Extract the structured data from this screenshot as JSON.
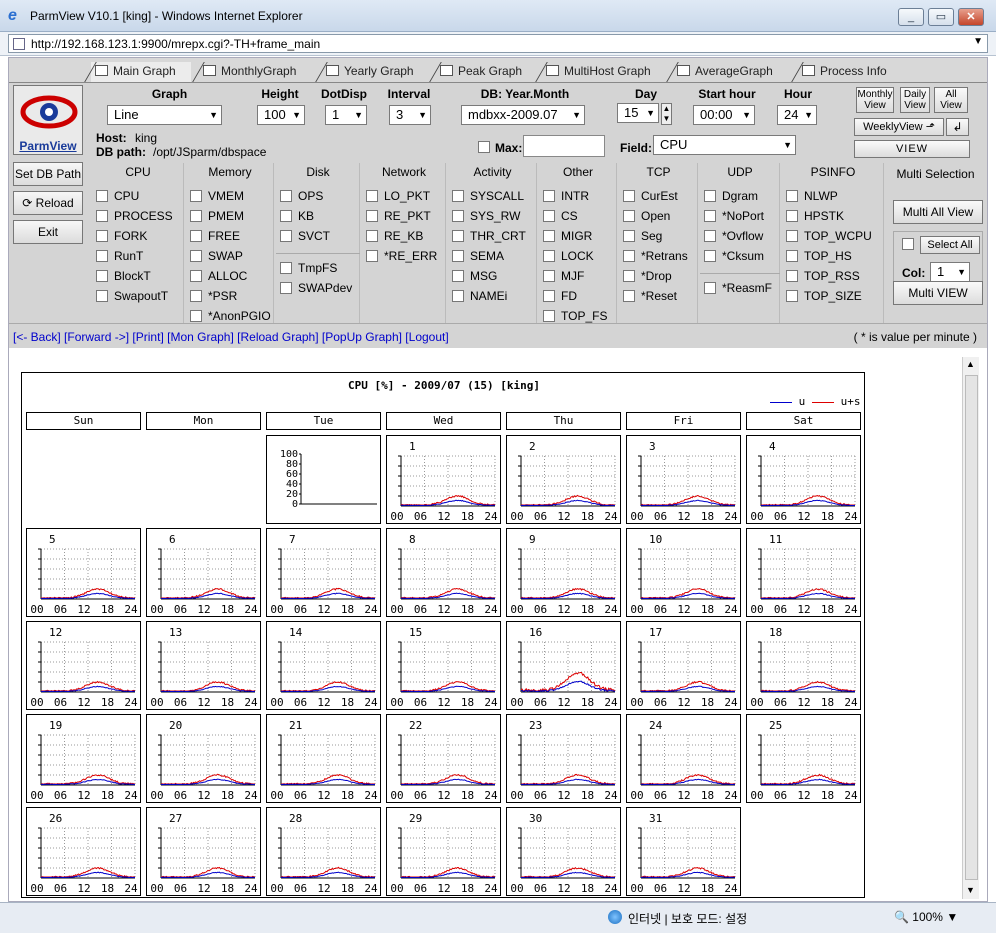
{
  "window": {
    "title": "ParmView V10.1 [king] - Windows Internet Explorer",
    "url": "http://192.168.123.1:9900/mrepx.cgi?-TH+frame_main"
  },
  "tabs": [
    "Main Graph",
    "MonthlyGraph",
    "Yearly Graph",
    "Peak Graph",
    "MultiHost Graph",
    "AverageGraph",
    "Process Info"
  ],
  "left": {
    "logo": "ParmView",
    "set_db": "Set DB Path",
    "reload": "⟳ Reload",
    "exit": "Exit"
  },
  "controls": {
    "headers": {
      "graph": "Graph",
      "height": "Height",
      "dotdisp": "DotDisp",
      "interval": "Interval",
      "db": "DB: Year.Month",
      "day": "Day",
      "start": "Start hour",
      "hour": "Hour"
    },
    "values": {
      "graph": "Line",
      "height": "100",
      "dotdisp": "1",
      "interval": "3",
      "db": "mdbxx-2009.07",
      "day": "15",
      "start": "00:00",
      "hour": "24"
    },
    "host_label": "Host:",
    "host": "king",
    "dbpath_label": "DB path:",
    "dbpath": "/opt/JSparm/dbspace",
    "max_label": "Max:",
    "field_label": "Field:",
    "field": "CPU"
  },
  "right_buttons": {
    "monthly": "Monthly View",
    "daily": "Daily View",
    "all": "All View",
    "weekly": "WeeklyView",
    "weekly_up": "⬏",
    "weekly_back": "↲",
    "view": "VIEW"
  },
  "categories": [
    {
      "name": "CPU",
      "items": [
        "CPU",
        "PROCESS",
        "FORK",
        "RunT",
        "BlockT",
        "SwapoutT"
      ]
    },
    {
      "name": "Memory",
      "items": [
        "VMEM",
        "PMEM",
        "FREE",
        "SWAP",
        "ALLOC",
        "*PSR",
        "*AnonPGIO"
      ]
    },
    {
      "name": "Disk",
      "items": [
        "OPS",
        "KB",
        "SVCT"
      ],
      "items2": [
        "TmpFS",
        "SWAPdev"
      ]
    },
    {
      "name": "Network",
      "items": [
        "LO_PKT",
        "RE_PKT",
        "RE_KB",
        "*RE_ERR"
      ]
    },
    {
      "name": "Activity",
      "items": [
        "SYSCALL",
        "SYS_RW",
        "THR_CRT",
        "SEMA",
        "MSG",
        "NAMEi"
      ]
    },
    {
      "name": "Other",
      "items": [
        "INTR",
        "CS",
        "MIGR",
        "LOCK",
        "MJF",
        "FD",
        "TOP_FS"
      ]
    },
    {
      "name": "TCP",
      "items": [
        "CurEst",
        "Open",
        "Seg",
        "*Retrans",
        "*Drop",
        "*Reset"
      ]
    },
    {
      "name": "UDP",
      "items": [
        "Dgram",
        "*NoPort",
        "*Ovflow",
        "*Cksum"
      ],
      "items2": [
        "*ReasmF"
      ]
    },
    {
      "name": "PSINFO",
      "items": [
        "NLWP",
        "HPSTK",
        "TOP_WCPU",
        "TOP_HS",
        "TOP_RSS",
        "TOP_SIZE"
      ]
    }
  ],
  "multi": {
    "header": "Multi Selection",
    "multi_all": "Multi All View",
    "select_all": "Select All",
    "col_label": "Col:",
    "col_value": "1",
    "multi_view": "Multi VIEW"
  },
  "links": {
    "back": "<- Back",
    "forward": "Forward ->",
    "print": "Print",
    "mon": "Mon Graph",
    "reload": "Reload Graph",
    "popup": "PopUp Graph",
    "logout": "Logout",
    "note": "( * is value per minute )"
  },
  "chart_data": {
    "type": "line",
    "title": "CPU [%] - 2009/07 (15) [king]",
    "legend": [
      "u",
      "u+s"
    ],
    "colors": {
      "u": "#0000cc",
      "us": "#dd0000"
    },
    "weekdays": [
      "Sun",
      "Mon",
      "Tue",
      "Wed",
      "Thu",
      "Fri",
      "Sat"
    ],
    "first_weekday": 3,
    "days": 31,
    "peak_day": 16,
    "ylim": [
      0,
      100
    ],
    "y_ticks": [
      "100",
      "80",
      "60",
      "40",
      "20",
      "0"
    ],
    "x_ticks": [
      "00",
      "06",
      "12",
      "18",
      "24"
    ]
  },
  "status": {
    "zone": "인터넷 | 보호 모드: 설정",
    "zoom": "100%"
  }
}
